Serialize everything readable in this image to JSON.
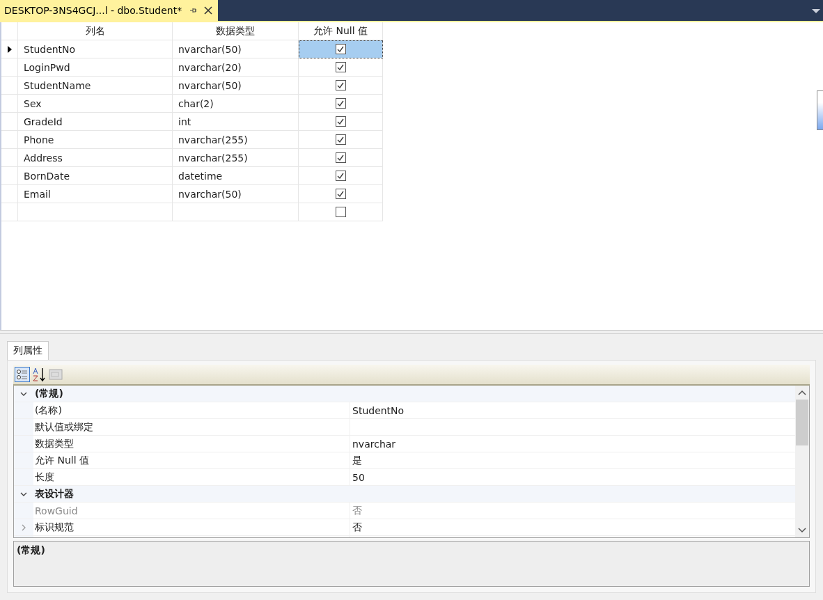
{
  "document_tab": {
    "title": "DESKTOP-3NS4GCJ...l - dbo.Student*",
    "active": true
  },
  "grid": {
    "columns": [
      "列名",
      "数据类型",
      "允许 Null 值"
    ],
    "rows": [
      {
        "name": "StudentNo",
        "type": "nvarchar(50)",
        "nullable": true,
        "selected": true
      },
      {
        "name": "LoginPwd",
        "type": "nvarchar(20)",
        "nullable": true,
        "selected": false
      },
      {
        "name": "StudentName",
        "type": "nvarchar(50)",
        "nullable": true,
        "selected": false
      },
      {
        "name": "Sex",
        "type": "char(2)",
        "nullable": true,
        "selected": false
      },
      {
        "name": "GradeId",
        "type": "int",
        "nullable": true,
        "selected": false
      },
      {
        "name": "Phone",
        "type": "nvarchar(255)",
        "nullable": true,
        "selected": false
      },
      {
        "name": "Address",
        "type": "nvarchar(255)",
        "nullable": true,
        "selected": false
      },
      {
        "name": "BornDate",
        "type": "datetime",
        "nullable": true,
        "selected": false
      },
      {
        "name": "Email",
        "type": "nvarchar(50)",
        "nullable": true,
        "selected": false
      },
      {
        "nullable": false,
        "selected": false
      }
    ]
  },
  "properties_panel": {
    "tab": "列属性",
    "categories": [
      {
        "name": "(常规)",
        "expanded": true,
        "items": [
          {
            "name": "(名称)",
            "value": "StudentNo",
            "disabled": false,
            "expandable": false
          },
          {
            "name": "默认值或绑定",
            "disabled": false,
            "expandable": false
          },
          {
            "name": "数据类型",
            "value": "nvarchar",
            "disabled": false,
            "expandable": false
          },
          {
            "name": "允许 Null 值",
            "value": "是",
            "disabled": false,
            "expandable": false
          },
          {
            "name": "长度",
            "value": "50",
            "disabled": false,
            "expandable": false
          }
        ]
      },
      {
        "name": "表设计器",
        "expanded": true,
        "items": [
          {
            "name": "RowGuid",
            "value": "否",
            "disabled": true,
            "expandable": false
          },
          {
            "name": "标识规范",
            "value": "否",
            "disabled": false,
            "expandable": true
          }
        ]
      }
    ],
    "description": "(常规)"
  }
}
